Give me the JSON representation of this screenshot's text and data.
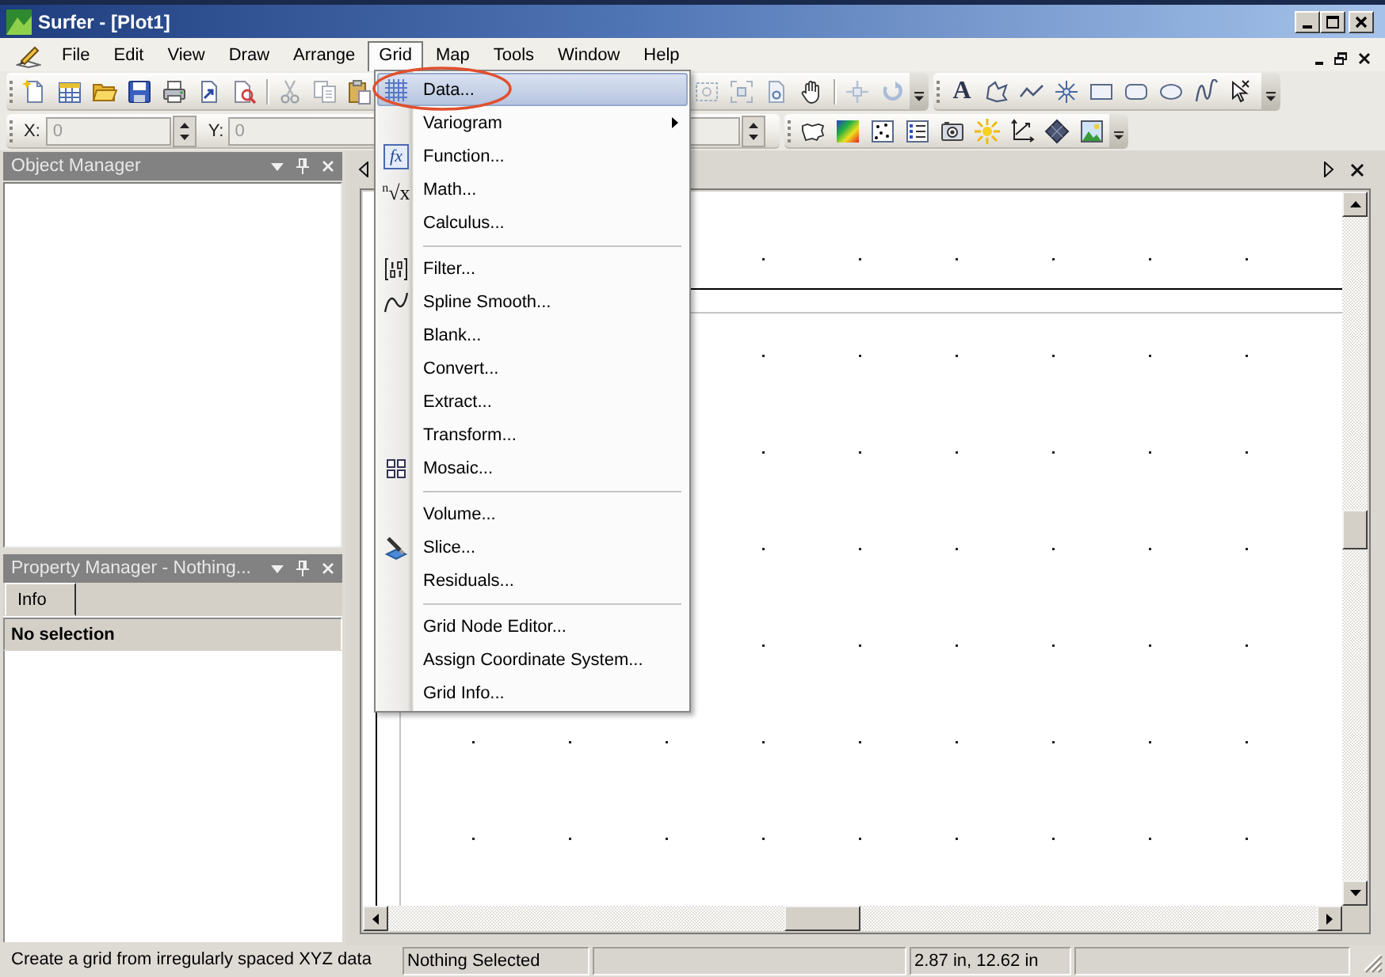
{
  "window": {
    "title": "Surfer - [Plot1]"
  },
  "menu_bar": [
    {
      "label": "File",
      "selected": false
    },
    {
      "label": "Edit",
      "selected": false
    },
    {
      "label": "View",
      "selected": false
    },
    {
      "label": "Draw",
      "selected": false
    },
    {
      "label": "Arrange",
      "selected": false
    },
    {
      "label": "Grid",
      "selected": true
    },
    {
      "label": "Map",
      "selected": false
    },
    {
      "label": "Tools",
      "selected": false
    },
    {
      "label": "Window",
      "selected": false
    },
    {
      "label": "Help",
      "selected": false
    }
  ],
  "drawing_toolbar": {
    "text_tool": "A"
  },
  "position_toolbar": {
    "fields": [
      {
        "label": "X:",
        "value": "0",
        "disabled": true
      },
      {
        "label": "Y:",
        "value": "0",
        "disabled": true
      }
    ]
  },
  "grid_menu": {
    "groups": [
      [
        {
          "label": "Data...",
          "selected": true,
          "submenu": false,
          "circled": true
        },
        {
          "label": "Variogram",
          "selected": false,
          "submenu": true,
          "circled": false
        },
        {
          "label": "Function...",
          "icon_text": "fx",
          "selected": false,
          "submenu": false,
          "circled": false
        },
        {
          "label": "Math...",
          "icon_text": "$^{n}$√x",
          "selected": false,
          "submenu": false,
          "circled": false
        },
        {
          "label": "Calculus...",
          "selected": false,
          "submenu": false,
          "circled": false
        }
      ],
      [
        {
          "label": "Filter...",
          "selected": false,
          "submenu": false,
          "circled": false
        },
        {
          "label": "Spline Smooth...",
          "selected": false,
          "submenu": false,
          "circled": false
        },
        {
          "label": "Blank...",
          "selected": false,
          "submenu": false,
          "circled": false
        },
        {
          "label": "Convert...",
          "selected": false,
          "submenu": false,
          "circled": false
        },
        {
          "label": "Extract...",
          "selected": false,
          "submenu": false,
          "circled": false
        },
        {
          "label": "Transform...",
          "selected": false,
          "submenu": false,
          "circled": false
        },
        {
          "label": "Mosaic...",
          "selected": false,
          "submenu": false,
          "circled": false
        }
      ],
      [
        {
          "label": "Volume...",
          "selected": false,
          "submenu": false,
          "circled": false
        },
        {
          "label": "Slice...",
          "selected": false,
          "submenu": false,
          "circled": false
        },
        {
          "label": "Residuals...",
          "selected": false,
          "submenu": false,
          "circled": false
        }
      ],
      [
        {
          "label": "Grid Node Editor...",
          "selected": false,
          "submenu": false,
          "circled": false
        },
        {
          "label": "Assign Coordinate System...",
          "selected": false,
          "submenu": false,
          "circled": false
        },
        {
          "label": "Grid Info...",
          "selected": false,
          "submenu": false,
          "circled": false
        }
      ]
    ]
  },
  "object_manager": {
    "title": "Object Manager"
  },
  "property_manager": {
    "title": "Property Manager - Nothing...",
    "tabs": [
      {
        "label": "Info",
        "selected": true
      }
    ],
    "header": "No selection"
  },
  "status_bar": {
    "message": "Create a grid from irregularly spaced XYZ data",
    "selection": "Nothing Selected",
    "cursor_position": "2.87 in, 12.62 in"
  }
}
